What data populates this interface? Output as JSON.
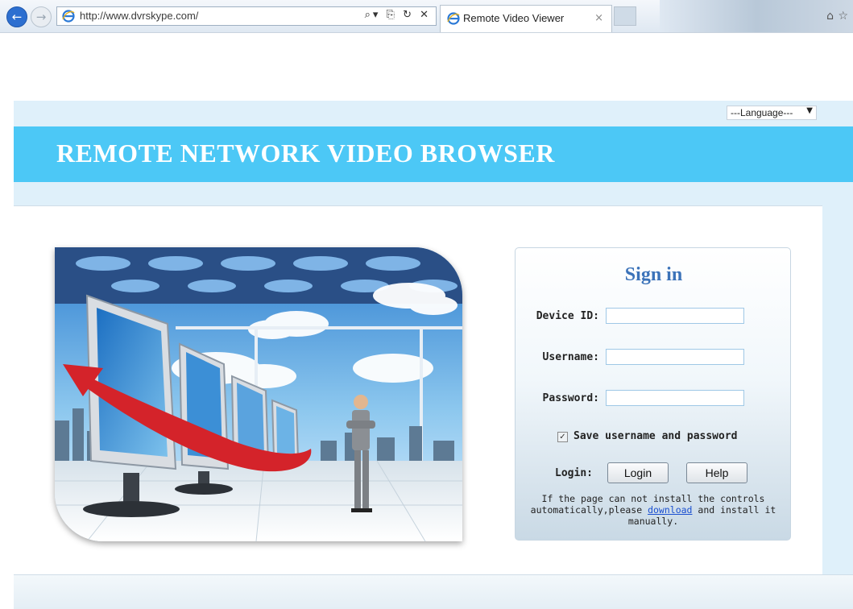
{
  "browser": {
    "url": "http://www.dvrskype.com/",
    "tab_title": "Remote Video Viewer",
    "address_controls": "⌕▾ ⎘ ↻ ✕",
    "close_glyph": "×",
    "back_glyph": "←",
    "forward_glyph": "→",
    "home_glyph": "⌂",
    "favorites_glyph": "☆"
  },
  "language": {
    "selected": "---Language---",
    "arrow": "▼"
  },
  "banner": {
    "title": "REMOTE NETWORK VIDEO BROWSER",
    "color": "#4cc8f6"
  },
  "signin": {
    "title": "Sign in",
    "device_id_label": "Device ID:",
    "username_label": "Username:",
    "password_label": "Password:",
    "device_id_value": "",
    "username_value": "",
    "password_value": "",
    "save_checked": true,
    "checkmark": "✓",
    "save_label": "Save username and password",
    "login_label": "Login:",
    "login_button": "Login",
    "help_button": "Help",
    "note_before": "If the page can not install the controls automatically,please ",
    "note_link": "download",
    "note_after": " and install it manually."
  },
  "colors": {
    "accent": "#3c73b9",
    "link": "#1a4fd0",
    "frame": "#dff0fa"
  },
  "icons": [
    "back-icon",
    "forward-icon",
    "ie-logo-icon",
    "search-icon",
    "refresh-icon",
    "stop-icon",
    "home-icon",
    "favorites-icon",
    "dropdown-arrow-icon",
    "checkbox-icon"
  ]
}
